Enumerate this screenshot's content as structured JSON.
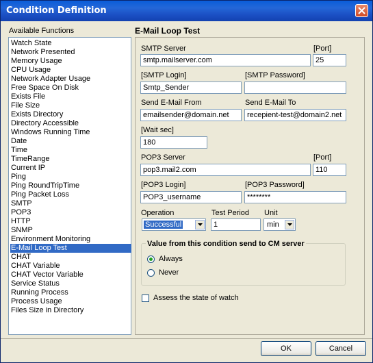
{
  "window": {
    "title": "Condition Definition"
  },
  "functions": {
    "label": "Available Functions",
    "items": [
      "Watch State",
      "Network Presented",
      "Memory Usage",
      "CPU Usage",
      "Network Adapter Usage",
      "Free Space On Disk",
      "Exists File",
      "File Size",
      "Exists Directory",
      "Directory Accessible",
      "Windows Running Time",
      "Date",
      "Time",
      "TimeRange",
      "Current IP",
      "Ping",
      "Ping RoundTripTime",
      "Ping Packet Loss",
      "SMTP",
      "POP3",
      "HTTP",
      "SNMP",
      "Environment Monitoring",
      "E-Mail Loop Test",
      "CHAT",
      "CHAT Variable",
      "CHAT Vector Variable",
      "Service Status",
      "Running Process",
      "Process Usage",
      "Files Size in Directory"
    ],
    "selected": "E-Mail Loop Test"
  },
  "form": {
    "title": "E-Mail Loop Test",
    "smtp_server_label": "SMTP Server",
    "smtp_server": "smtp.mailserver.com",
    "smtp_port_label": "[Port]",
    "smtp_port": "25",
    "smtp_login_label": "[SMTP Login]",
    "smtp_login": "Smtp_Sender",
    "smtp_password_label": "[SMTP Password]",
    "smtp_password": "",
    "send_from_label": "Send E-Mail From",
    "send_from": "emailsender@domain.net",
    "send_to_label": "Send E-Mail To",
    "send_to": "recepient-test@domain2.net",
    "wait_label": "[Wait sec]",
    "wait": "180",
    "pop3_server_label": "POP3 Server",
    "pop3_server": "pop3.mail2.com",
    "pop3_port_label": "[Port]",
    "pop3_port": "110",
    "pop3_login_label": "[POP3 Login]",
    "pop3_login": "POP3_username",
    "pop3_password_label": "[POP3 Password]",
    "pop3_password": "********",
    "operation_label": "Operation",
    "operation": "Successful",
    "test_period_label": "Test Period",
    "test_period": "1",
    "unit_label": "Unit",
    "unit": "min",
    "group_title": "Value from this condition send to CM server",
    "radio_always": "Always",
    "radio_never": "Never",
    "radio_selected": "Always",
    "assess_label": "Assess the state of watch",
    "assess_checked": false
  },
  "buttons": {
    "ok": "OK",
    "cancel": "Cancel"
  }
}
